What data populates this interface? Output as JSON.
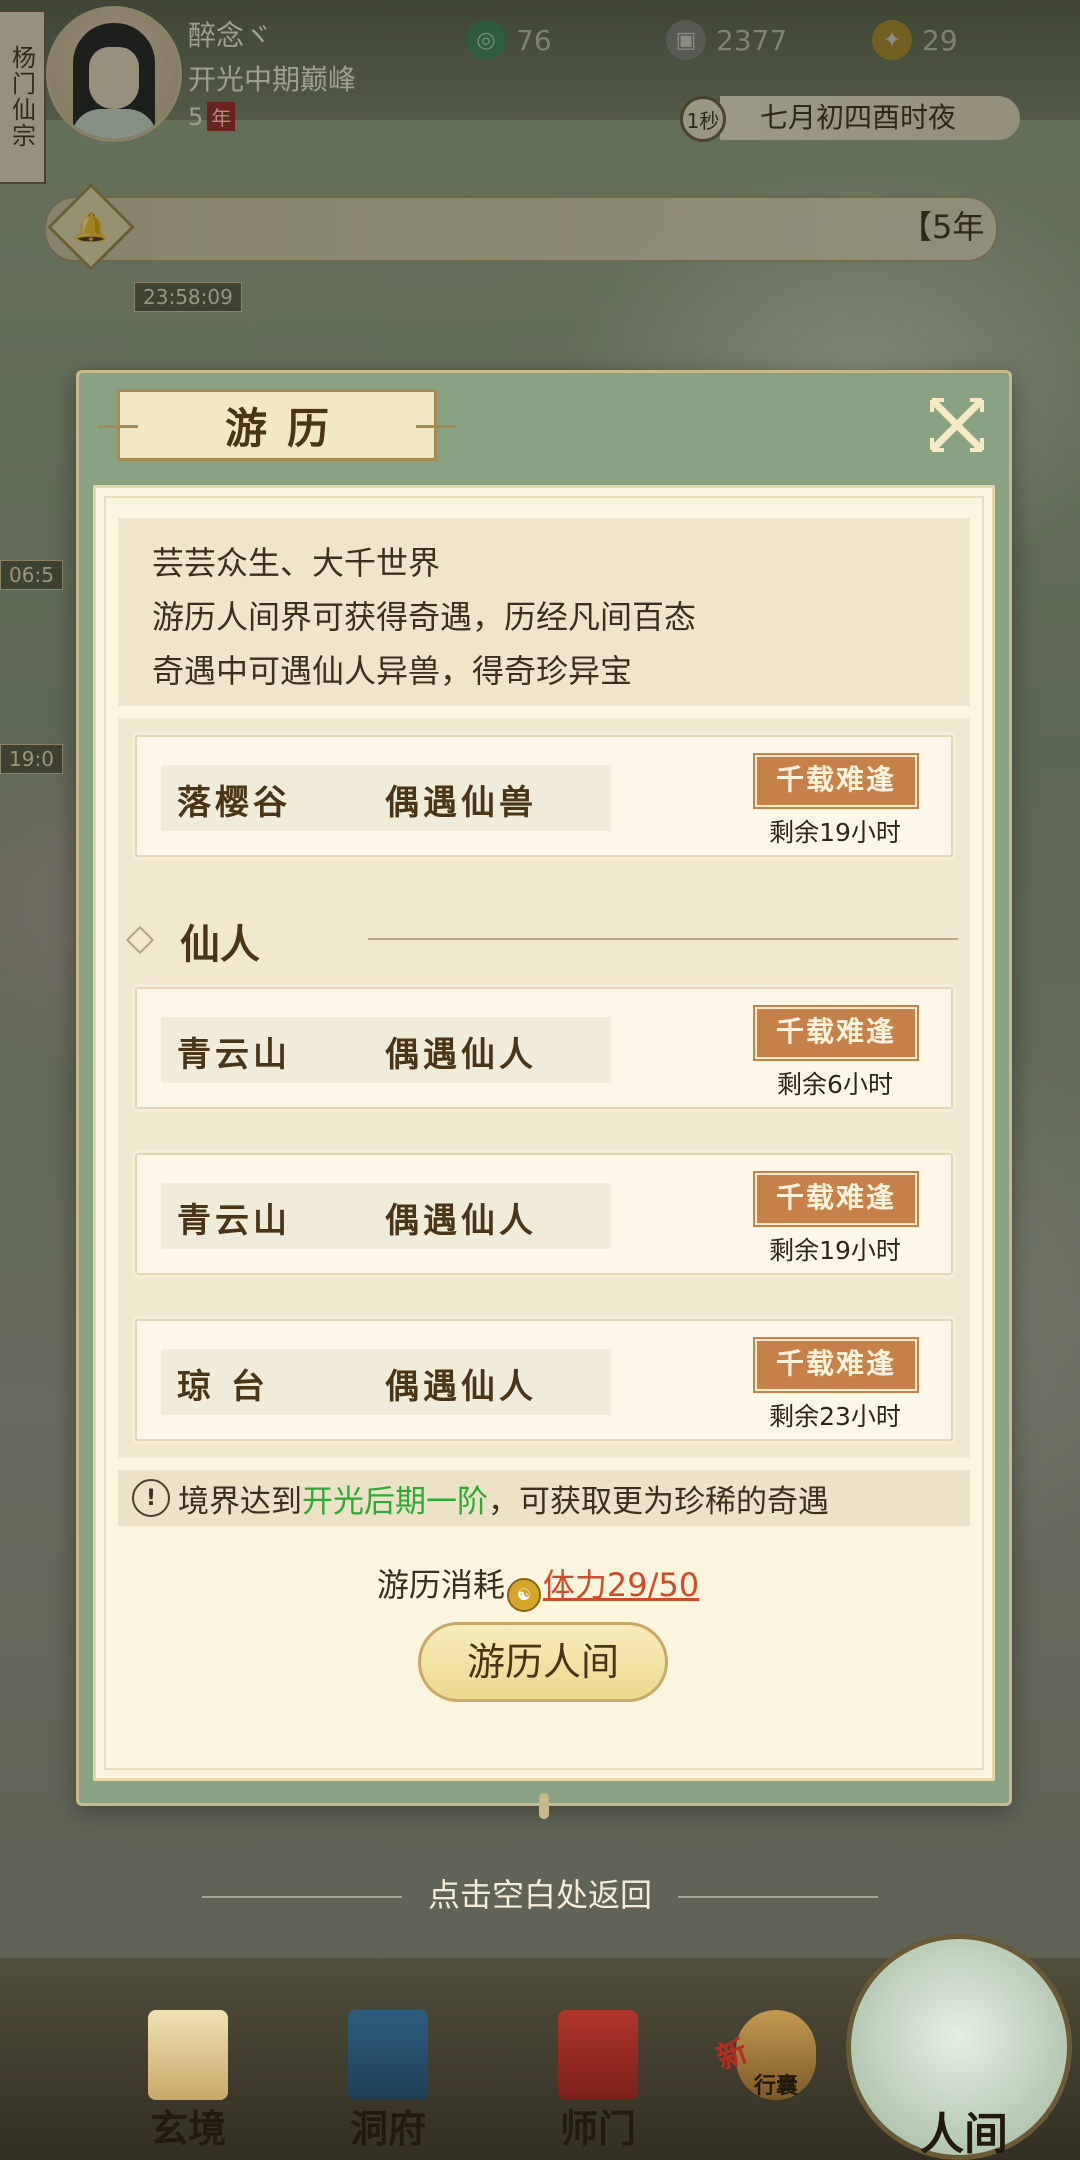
{
  "player": {
    "sect": "杨门仙宗",
    "name": "醉念ヾ",
    "realm": "开光中期巅峰",
    "years": "5",
    "year_unit": "年"
  },
  "resources": [
    {
      "icon": "jade-icon",
      "value": "76"
    },
    {
      "icon": "coin-icon",
      "value": "2377"
    },
    {
      "icon": "strength-icon",
      "value": "29"
    }
  ],
  "clock": {
    "timer": "1秒",
    "date": "七月初四酉时夜"
  },
  "notice": {
    "text": "【5年"
  },
  "map_timers": [
    "23:58:09",
    "06:5",
    "19:0"
  ],
  "dialog": {
    "title": "游历",
    "description": [
      "芸芸众生、大千世界",
      "游历人间界可获得奇遇，历经凡间百态",
      "奇遇中可遇仙人异兽，得奇珍异宝"
    ],
    "encounters_top": [
      {
        "place": "落樱谷",
        "type": "偶遇仙兽",
        "rarity": "千载难逢",
        "remaining": "剩余19小时"
      }
    ],
    "section_title": "仙人",
    "encounters": [
      {
        "place": "青云山",
        "type": "偶遇仙人",
        "rarity": "千载难逢",
        "remaining": "剩余6小时"
      },
      {
        "place": "青云山",
        "type": "偶遇仙人",
        "rarity": "千载难逢",
        "remaining": "剩余19小时"
      },
      {
        "place": "琼 台",
        "type": "偶遇仙人",
        "rarity": "千载难逢",
        "remaining": "剩余23小时"
      }
    ],
    "tip": {
      "prefix": "境界达到",
      "highlight": "开光后期一阶",
      "suffix": "，可获取更为珍稀的奇遇"
    },
    "cost_label": "游历消耗",
    "stamina": "体力29/50",
    "button": "游历人间"
  },
  "back_hint": "点击空白处返回",
  "nav": [
    {
      "label": "玄境",
      "icon": "scroll-icon"
    },
    {
      "label": "洞府",
      "icon": "pavilion-icon"
    },
    {
      "label": "师门",
      "icon": "banner-icon"
    },
    {
      "label": "行囊",
      "icon": "bag-icon",
      "badge": "新"
    },
    {
      "label": "人间",
      "icon": "landscape-icon"
    }
  ],
  "colors": {
    "accent": "#c6814a",
    "highlight": "#2eaa36",
    "stamina": "#d24a2c",
    "frame": "#8aa284"
  }
}
